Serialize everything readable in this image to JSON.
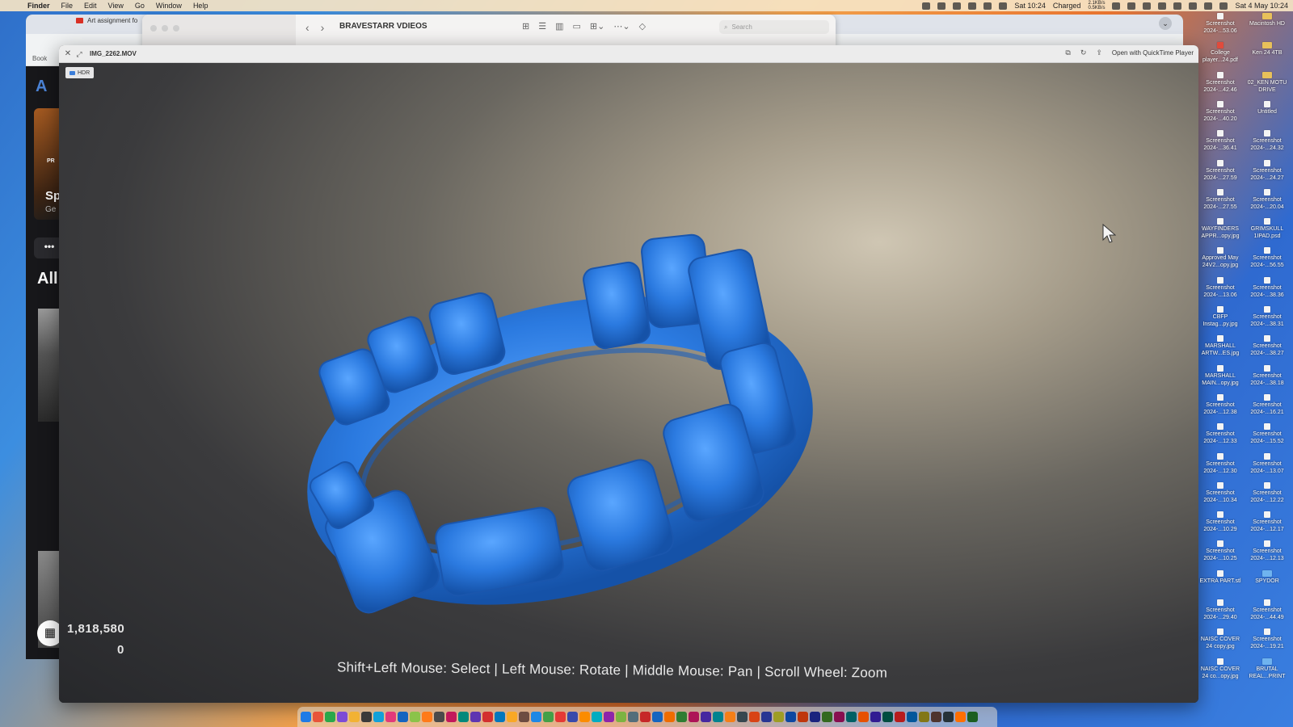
{
  "menubar": {
    "app_name": "Finder",
    "items": [
      "File",
      "Edit",
      "View",
      "Go",
      "Window",
      "Help"
    ],
    "status": {
      "clock_short": "Sat 10:24",
      "battery": "Charged",
      "net_up": "2.1KB/s",
      "net_down": "0.5KB/s",
      "datetime": "Sat 4 May 10:24"
    }
  },
  "finder": {
    "title": "BRAVESTARR VDIEOS",
    "search_placeholder": "Search"
  },
  "browser": {
    "tab_title": "Art assignment fo",
    "bookmarks_label": "Book"
  },
  "web_page": {
    "badge": "PR",
    "card_title": "Sp",
    "card_subtitle": "Ge",
    "section_heading": "All",
    "more_label": "•••"
  },
  "quicklook": {
    "filename": "IMG_2262.MOV",
    "open_with_label": "Open with QuickTime Player",
    "hdr_label": "HDR",
    "stat_count": "1,818,580",
    "stat_zero": "0",
    "hint": "Shift+Left Mouse: Select | Left Mouse: Rotate | Middle Mouse: Pan | Scroll Wheel: Zoom",
    "model_color": "#2f7fe0"
  },
  "desktop": {
    "col1": [
      {
        "label": "Screenshot 2024-...53.06",
        "icon": "image"
      },
      {
        "label": "College player...24.pdf",
        "icon": "pdf"
      },
      {
        "label": "Screenshot 2024-...42.46",
        "icon": "image"
      },
      {
        "label": "Screenshot 2024-...40.20",
        "icon": "image"
      },
      {
        "label": "Screenshot 2024-...36.41",
        "icon": "image"
      },
      {
        "label": "Screenshot 2024-...27.59",
        "icon": "image"
      },
      {
        "label": "Screenshot 2024-...27.55",
        "icon": "image"
      },
      {
        "label": "WAYFINDERS APPR...opy.jpg",
        "icon": "image"
      },
      {
        "label": "Approved May 24V2...opy.jpg",
        "icon": "image"
      },
      {
        "label": "Screenshot 2024-...13.06",
        "icon": "image"
      },
      {
        "label": "CBFP Instag...py.jpg",
        "icon": "image"
      },
      {
        "label": "MARSHALL ARTW...ES.jpg",
        "icon": "image"
      },
      {
        "label": "MARSHALL MAIN...opy.jpg",
        "icon": "image"
      },
      {
        "label": "Screenshot 2024-...12.38",
        "icon": "image"
      },
      {
        "label": "Screenshot 2024-...12.33",
        "icon": "image"
      },
      {
        "label": "Screenshot 2024-...12.30",
        "icon": "image"
      },
      {
        "label": "Screenshot 2024-...10.34",
        "icon": "image"
      },
      {
        "label": "Screenshot 2024-...10.29",
        "icon": "image"
      },
      {
        "label": "Screenshot 2024-...10.25",
        "icon": "image"
      },
      {
        "label": "EXTRA PART.stl",
        "icon": "file"
      },
      {
        "label": "Screenshot 2024-...29.40",
        "icon": "image"
      },
      {
        "label": "NAISC COVER 24 copy.jpg",
        "icon": "image"
      },
      {
        "label": "NAISC COVER 24 co...opy.jpg",
        "icon": "image"
      }
    ],
    "col2": [
      {
        "label": "Macintosh HD",
        "icon": "drive"
      },
      {
        "label": "Ken 24 4TB",
        "icon": "drive"
      },
      {
        "label": "02_KEN MOTU DRIVE",
        "icon": "drive"
      },
      {
        "label": "Untitled",
        "icon": "file"
      },
      {
        "label": "Screenshot 2024-...24.32",
        "icon": "image"
      },
      {
        "label": "Screenshot 2024-...24.27",
        "icon": "image"
      },
      {
        "label": "Screenshot 2024-...20.04",
        "icon": "image"
      },
      {
        "label": "GRIMSKULL 1IPAD.psd",
        "icon": "file"
      },
      {
        "label": "Screenshot 2024-...56.55",
        "icon": "image"
      },
      {
        "label": "Screenshot 2024-...38.36",
        "icon": "image"
      },
      {
        "label": "Screenshot 2024-...38.31",
        "icon": "image"
      },
      {
        "label": "Screenshot 2024-...38.27",
        "icon": "image"
      },
      {
        "label": "Screenshot 2024-...38.18",
        "icon": "image"
      },
      {
        "label": "Screenshot 2024-...16.21",
        "icon": "image"
      },
      {
        "label": "Screenshot 2024-...15.52",
        "icon": "image"
      },
      {
        "label": "Screenshot 2024-...13.07",
        "icon": "image"
      },
      {
        "label": "Screenshot 2024-...12.22",
        "icon": "image"
      },
      {
        "label": "Screenshot 2024-...12.17",
        "icon": "image"
      },
      {
        "label": "Screenshot 2024-...12.13",
        "icon": "image"
      },
      {
        "label": "SPYDOR",
        "icon": "folder"
      },
      {
        "label": "Screenshot 2024-...44.49",
        "icon": "image"
      },
      {
        "label": "Screenshot 2024-...19.21",
        "icon": "image"
      },
      {
        "label": "BRUTAL REAL...PRINT",
        "icon": "folder"
      }
    ]
  },
  "dock": {
    "app_colors": [
      "#1e7be6",
      "#e8543a",
      "#2aa84a",
      "#7d4bd6",
      "#f2b233",
      "#3a3a3a",
      "#13a1d8",
      "#e23a7a",
      "#1564c0",
      "#8bc34a",
      "#ff7a1a",
      "#4a4a4a",
      "#c2185b",
      "#00897b",
      "#5e35b1",
      "#d32f2f",
      "#0277bd",
      "#f9a825",
      "#6d4c41",
      "#1e88e5",
      "#43a047",
      "#e53935",
      "#3949ab",
      "#fb8c00",
      "#00acc1",
      "#8e24aa",
      "#7cb342",
      "#546e7a",
      "#c62828",
      "#1565c0",
      "#ef6c00",
      "#2e7d32",
      "#ad1457",
      "#4527a0",
      "#00838f",
      "#f57f17",
      "#37474f",
      "#d84315",
      "#283593",
      "#9e9d24",
      "#0d47a1",
      "#bf360c",
      "#1a237e",
      "#33691e",
      "#880e4f",
      "#006064",
      "#e65100",
      "#311b92",
      "#004d40",
      "#b71c1c",
      "#01579b",
      "#827717",
      "#4e342e",
      "#263238",
      "#ff6f00",
      "#1b5e20"
    ]
  }
}
